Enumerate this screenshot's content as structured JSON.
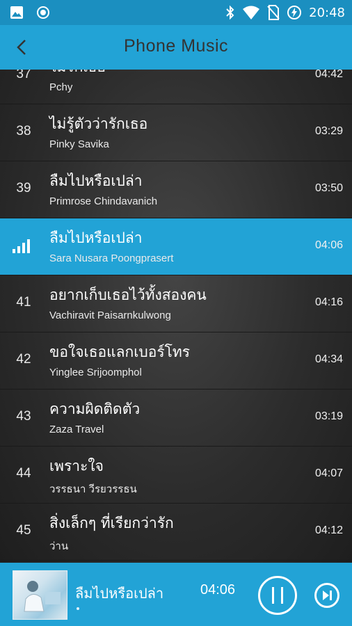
{
  "status_bar": {
    "time": "20:48",
    "left_icons": [
      "image-icon",
      "record-icon"
    ],
    "right_icons": [
      "bluetooth-icon",
      "wifi-icon",
      "no-sim-icon",
      "battery-charging-icon"
    ]
  },
  "header": {
    "title": "Phone Music",
    "back_icon": "chevron-left-icon"
  },
  "tracks": [
    {
      "num": "37",
      "title": "ไม่รักเธอ",
      "artist": "Pchy",
      "duration": "04:42",
      "active": false
    },
    {
      "num": "38",
      "title": "ไม่รู้ตัวว่ารักเธอ",
      "artist": "Pinky Savika",
      "duration": "03:29",
      "active": false
    },
    {
      "num": "39",
      "title": "ลืมไปหรือเปล่า",
      "artist": "Primrose Chindavanich",
      "duration": "03:50",
      "active": false
    },
    {
      "num": "",
      "title": "ลืมไปหรือเปล่า",
      "artist": "Sara Nusara Poongprasert",
      "duration": "04:06",
      "active": true
    },
    {
      "num": "41",
      "title": "อยากเก็บเธอไว้ทั้งสองคน",
      "artist": "Vachiravit Paisarnkulwong",
      "duration": "04:16",
      "active": false
    },
    {
      "num": "42",
      "title": "ขอใจเธอแลกเบอร์โทร",
      "artist": "Yinglee Srijoomphol",
      "duration": "04:34",
      "active": false
    },
    {
      "num": "43",
      "title": "ความผิดติดตัว",
      "artist": "Zaza Travel",
      "duration": "03:19",
      "active": false
    },
    {
      "num": "44",
      "title": "เพราะใจ",
      "artist": "วรรธนา วีรยวรรธน",
      "duration": "04:07",
      "active": false
    },
    {
      "num": "45",
      "title": "สิ่งเล็กๆ ที่เรียกว่ารัก",
      "artist": "ว่าน",
      "duration": "04:12",
      "active": false
    }
  ],
  "now_playing": {
    "title": "ลืมไปหรือเปล่า",
    "time": "04:06"
  },
  "colors": {
    "accent": "#22a3d6",
    "status_bar": "#1b8fc0"
  }
}
